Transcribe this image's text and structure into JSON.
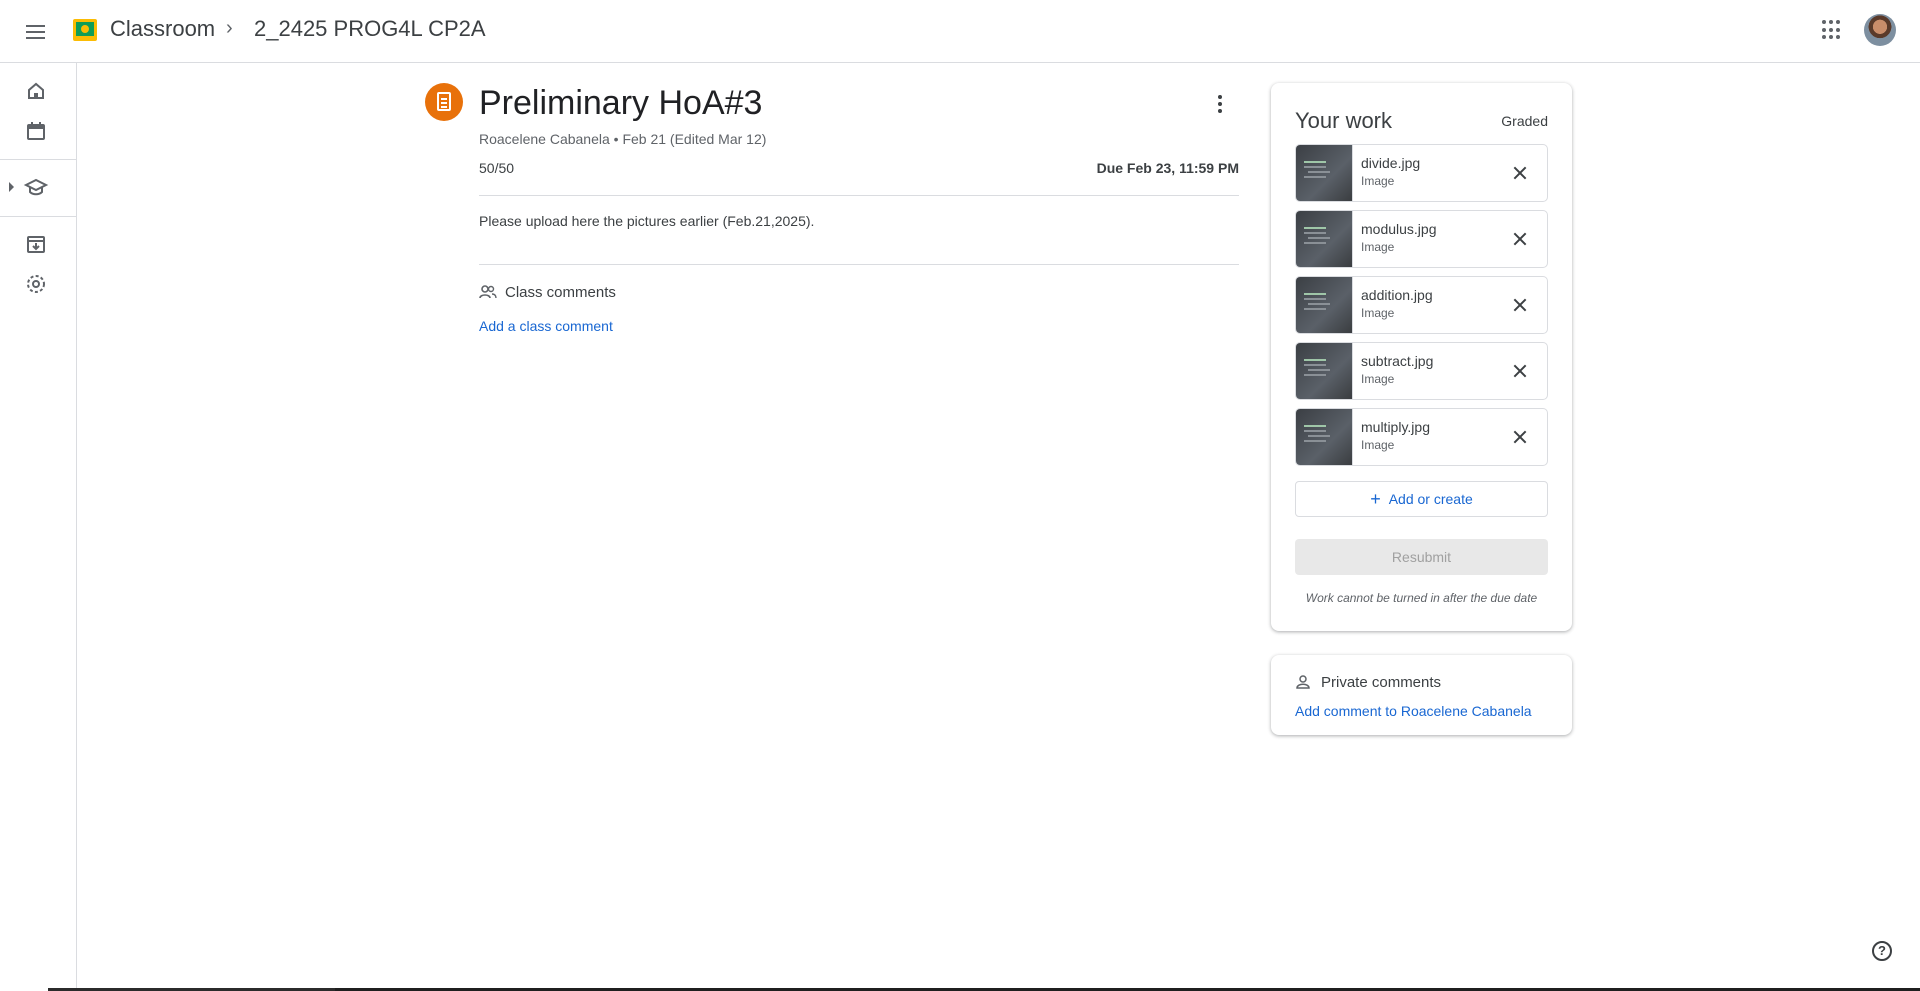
{
  "header": {
    "app_name": "Classroom",
    "separator": "›",
    "class_name": "2_2425 PROG4L CP2A",
    "icons": [
      "menu-icon",
      "classroom-logo",
      "apps-grid-icon",
      "avatar"
    ]
  },
  "sidebar": {
    "items": [
      {
        "name": "home-icon"
      },
      {
        "name": "calendar-icon"
      },
      {
        "name": "enrolled-icon"
      },
      {
        "name": "archived-icon"
      },
      {
        "name": "settings-icon"
      }
    ]
  },
  "assignment": {
    "title": "Preliminary HoA#3",
    "meta": "Roacelene Cabanela • Feb 21 (Edited Mar 12)",
    "points": "50/50",
    "due": "Due Feb 23, 11:59 PM",
    "description": "Please upload here the pictures earlier (Feb.21,2025).",
    "accent_color": "#e8710a"
  },
  "class_comments": {
    "label": "Class comments",
    "add_label": "Add a class comment"
  },
  "your_work": {
    "title": "Your work",
    "status": "Graded",
    "attachments": [
      {
        "name": "divide.jpg",
        "type": "Image"
      },
      {
        "name": "modulus.jpg",
        "type": "Image"
      },
      {
        "name": "addition.jpg",
        "type": "Image"
      },
      {
        "name": "subtract.jpg",
        "type": "Image"
      },
      {
        "name": "multiply.jpg",
        "type": "Image"
      }
    ],
    "add_label": "Add or create",
    "add_icon": "+",
    "resubmit_label": "Resubmit",
    "notice": "Work cannot be turned in after the due date"
  },
  "private_comments": {
    "label": "Private comments",
    "add_label": "Add comment to Roacelene Cabanela"
  },
  "help": {
    "label": "?"
  },
  "colors": {
    "link": "#1967d2",
    "divider": "#dadce0",
    "text": "#3c4043"
  }
}
